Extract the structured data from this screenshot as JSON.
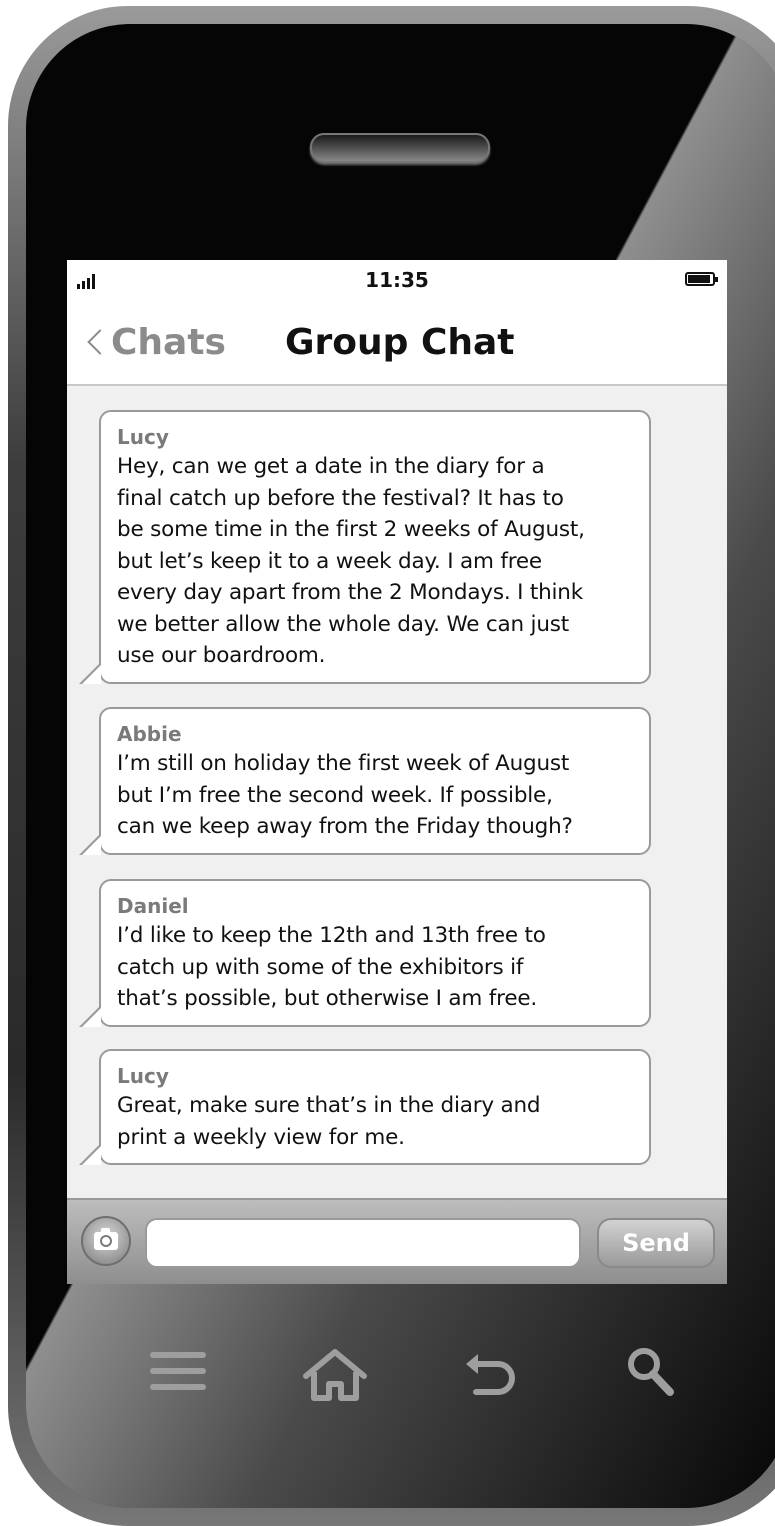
{
  "status_bar": {
    "time": "11:35"
  },
  "nav": {
    "back_label": "Chats",
    "title": "Group Chat"
  },
  "messages": [
    {
      "sender": "Lucy",
      "lines": [
        "Hey, can we get a date in the diary for a",
        "final catch up before the festival? It has to",
        "be some time in the first 2 weeks of August,",
        "but let’s keep it to a week day. I am free",
        "every day apart from the 2 Mondays. I think",
        "we better allow the whole day. We can just",
        "use our boardroom."
      ]
    },
    {
      "sender": "Abbie",
      "lines": [
        "I’m still on holiday the first week of August",
        "but I’m free the second week. If possible,",
        "can we keep away from the Friday though?"
      ]
    },
    {
      "sender": "Daniel",
      "lines": [
        "I’d like to keep the 12th and 13th free to",
        "catch up with some of the exhibitors if",
        "that’s possible, but otherwise I am free."
      ]
    },
    {
      "sender": "Lucy",
      "lines": [
        "Great, make sure that’s in the diary and",
        "print a weekly view for me."
      ]
    }
  ],
  "input_bar": {
    "message_value": "",
    "send_label": "Send"
  },
  "icons": {
    "signal": "signal-bars-icon",
    "battery": "battery-icon",
    "back": "chevron-left-icon",
    "camera": "camera-icon",
    "menu": "menu-icon",
    "home": "home-icon",
    "return": "back-arrow-icon",
    "search": "search-icon"
  },
  "colors": {
    "screen_background": "#f0f0f0",
    "bubble_border": "#9a9a9a",
    "sender_text": "#7a7a7a",
    "nav_icons": "#9e9e9e"
  }
}
